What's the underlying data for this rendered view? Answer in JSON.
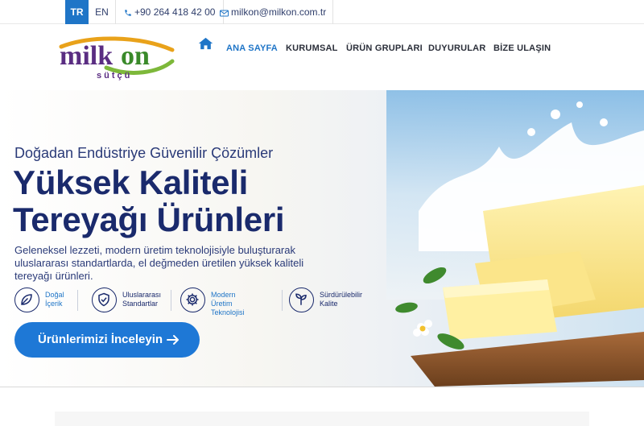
{
  "topbar": {
    "languages": [
      {
        "code": "TR",
        "active": true
      },
      {
        "code": "EN",
        "active": false
      }
    ],
    "phone": "+90 264 418 42 00",
    "email": "milkon@milkon.com.tr"
  },
  "logo": {
    "brand": "milkon",
    "tagline": "sütçü"
  },
  "nav": {
    "items": [
      {
        "label": "ANA SAYFA",
        "active": true
      },
      {
        "label": "KURUMSAL",
        "active": false
      },
      {
        "label": "ÜRÜN GRUPLARI",
        "active": false
      },
      {
        "label": "DUYURULAR",
        "active": false
      },
      {
        "label": "BİZE ULAŞIN",
        "active": false
      }
    ]
  },
  "hero": {
    "subtitle_part1": "Doğadan Endüstriye",
    "subtitle_part2": "Güvenilir Çözümler",
    "headline_line1": "Yüksek Kaliteli",
    "headline_line2": "Tereyağı Ürünleri",
    "description": "Geleneksel lezzeti, modern üretim teknolojisiyle buluşturarak uluslararası standartlarda, el değmeden üretilen yüksek kaliteli tereyağı ürünleri.",
    "features": [
      {
        "icon": "leaf-icon",
        "line1": "Doğal",
        "line2": "İçerik"
      },
      {
        "icon": "shield-check-icon",
        "line1": "Uluslararası",
        "line2": "Standartlar"
      },
      {
        "icon": "gear-icon",
        "line1": "Modern",
        "line2": "Üretim Teknolojisi"
      },
      {
        "icon": "sprout-icon",
        "line1": "Sürdürülebilir",
        "line2": "Kalite"
      }
    ],
    "cta_label": "Ürünlerimizi İnceleyin"
  },
  "colors": {
    "accent": "#1f75c7",
    "headline": "#1a2a6c",
    "cta": "#1e78d6"
  }
}
